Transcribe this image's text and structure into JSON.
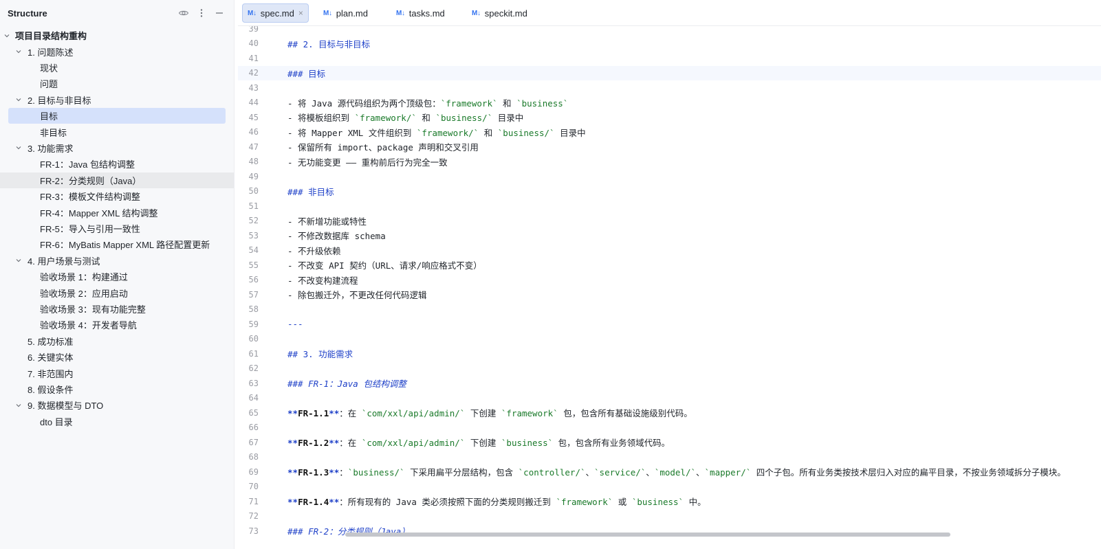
{
  "structure": {
    "title": "Structure",
    "tools": [
      "eye-icon",
      "more-vertical-icon",
      "minimize-icon"
    ],
    "items": [
      {
        "label": "项目目录结构重构",
        "level": 0,
        "expanded": true
      },
      {
        "label": "1. 问题陈述",
        "level": 1,
        "expanded": true
      },
      {
        "label": "现状",
        "level": 2
      },
      {
        "label": "问题",
        "level": 2
      },
      {
        "label": "2. 目标与非目标",
        "level": 1,
        "expanded": true
      },
      {
        "label": "目标",
        "level": 2,
        "selected": true
      },
      {
        "label": "非目标",
        "level": 2
      },
      {
        "label": "3. 功能需求",
        "level": 1,
        "expanded": true
      },
      {
        "label": "FR-1：Java 包结构调整",
        "level": 2
      },
      {
        "label": "FR-2：分类规则（Java）",
        "level": 2,
        "hover": true
      },
      {
        "label": "FR-3：模板文件结构调整",
        "level": 2
      },
      {
        "label": "FR-4：Mapper XML 结构调整",
        "level": 2
      },
      {
        "label": "FR-5：导入与引用一致性",
        "level": 2
      },
      {
        "label": "FR-6：MyBatis Mapper XML 路径配置更新",
        "level": 2
      },
      {
        "label": "4. 用户场景与测试",
        "level": 1,
        "expanded": true
      },
      {
        "label": "验收场景 1：构建通过",
        "level": 2
      },
      {
        "label": "验收场景 2：应用启动",
        "level": 2
      },
      {
        "label": "验收场景 3：现有功能完整",
        "level": 2
      },
      {
        "label": "验收场景 4：开发者导航",
        "level": 2
      },
      {
        "label": "5. 成功标准",
        "level": 1
      },
      {
        "label": "6. 关键实体",
        "level": 1
      },
      {
        "label": "7. 非范围内",
        "level": 1
      },
      {
        "label": "8. 假设条件",
        "level": 1
      },
      {
        "label": "9. 数据模型与 DTO",
        "level": 1,
        "expanded": true
      },
      {
        "label": "dto 目录",
        "level": 2
      }
    ]
  },
  "tabs": [
    {
      "badge": "M↓",
      "label": "spec.md",
      "active": true,
      "close": "×"
    },
    {
      "badge": "M↓",
      "label": "plan.md"
    },
    {
      "badge": "M↓",
      "label": "tasks.md"
    },
    {
      "badge": "M↓",
      "label": "speckit.md"
    }
  ],
  "editor": {
    "current_line": "42",
    "lines": [
      {
        "n": "39",
        "segs": []
      },
      {
        "n": "40",
        "segs": [
          {
            "c": "hd",
            "t": "## 2. 目标与非目标"
          }
        ]
      },
      {
        "n": "41",
        "segs": []
      },
      {
        "n": "42",
        "segs": [
          {
            "c": "hd",
            "t": "### 目标"
          }
        ]
      },
      {
        "n": "43",
        "segs": []
      },
      {
        "n": "44",
        "segs": [
          {
            "c": "",
            "t": "- 将 Java 源代码组织为两个顶级包："
          },
          {
            "c": "bt",
            "t": "`framework`"
          },
          {
            "c": "",
            "t": " 和 "
          },
          {
            "c": "bt",
            "t": "`business`"
          }
        ]
      },
      {
        "n": "45",
        "segs": [
          {
            "c": "",
            "t": "- 将模板组织到 "
          },
          {
            "c": "bt",
            "t": "`framework/`"
          },
          {
            "c": "",
            "t": " 和 "
          },
          {
            "c": "bt",
            "t": "`business/`"
          },
          {
            "c": "",
            "t": " 目录中"
          }
        ]
      },
      {
        "n": "46",
        "segs": [
          {
            "c": "",
            "t": "- 将 Mapper XML 文件组织到 "
          },
          {
            "c": "bt",
            "t": "`framework/`"
          },
          {
            "c": "",
            "t": " 和 "
          },
          {
            "c": "bt",
            "t": "`business/`"
          },
          {
            "c": "",
            "t": " 目录中"
          }
        ]
      },
      {
        "n": "47",
        "segs": [
          {
            "c": "",
            "t": "- 保留所有 import、package 声明和交叉引用"
          }
        ]
      },
      {
        "n": "48",
        "segs": [
          {
            "c": "",
            "t": "- 无功能变更 —— 重构前后行为完全一致"
          }
        ]
      },
      {
        "n": "49",
        "segs": []
      },
      {
        "n": "50",
        "segs": [
          {
            "c": "hd",
            "t": "### 非目标"
          }
        ]
      },
      {
        "n": "51",
        "segs": []
      },
      {
        "n": "52",
        "segs": [
          {
            "c": "",
            "t": "- 不新增功能或特性"
          }
        ]
      },
      {
        "n": "53",
        "segs": [
          {
            "c": "",
            "t": "- 不修改数据库 schema"
          }
        ]
      },
      {
        "n": "54",
        "segs": [
          {
            "c": "",
            "t": "- 不升级依赖"
          }
        ]
      },
      {
        "n": "55",
        "segs": [
          {
            "c": "",
            "t": "- 不改变 API 契约（URL、请求/响应格式不变）"
          }
        ]
      },
      {
        "n": "56",
        "segs": [
          {
            "c": "",
            "t": "- 不改变构建流程"
          }
        ]
      },
      {
        "n": "57",
        "segs": [
          {
            "c": "",
            "t": "- 除包搬迁外，不更改任何代码逻辑"
          }
        ]
      },
      {
        "n": "58",
        "segs": []
      },
      {
        "n": "59",
        "segs": [
          {
            "c": "hr",
            "t": "---"
          }
        ]
      },
      {
        "n": "60",
        "segs": []
      },
      {
        "n": "61",
        "segs": [
          {
            "c": "hd",
            "t": "## 3. 功能需求"
          }
        ]
      },
      {
        "n": "62",
        "segs": []
      },
      {
        "n": "63",
        "segs": [
          {
            "c": "hd",
            "t": "### "
          },
          {
            "c": "hd-it",
            "t": "FR-1：Java 包结构调整"
          }
        ]
      },
      {
        "n": "64",
        "segs": []
      },
      {
        "n": "65",
        "segs": [
          {
            "c": "star",
            "t": "**"
          },
          {
            "c": "bold",
            "t": "FR-1.1"
          },
          {
            "c": "star",
            "t": "**"
          },
          {
            "c": "",
            "t": "：在 "
          },
          {
            "c": "bt",
            "t": "`com/xxl/api/admin/`"
          },
          {
            "c": "",
            "t": " 下创建 "
          },
          {
            "c": "bt",
            "t": "`framework`"
          },
          {
            "c": "",
            "t": " 包，包含所有基础设施级别代码。"
          }
        ]
      },
      {
        "n": "66",
        "segs": []
      },
      {
        "n": "67",
        "segs": [
          {
            "c": "star",
            "t": "**"
          },
          {
            "c": "bold",
            "t": "FR-1.2"
          },
          {
            "c": "star",
            "t": "**"
          },
          {
            "c": "",
            "t": "：在 "
          },
          {
            "c": "bt",
            "t": "`com/xxl/api/admin/`"
          },
          {
            "c": "",
            "t": " 下创建 "
          },
          {
            "c": "bt",
            "t": "`business`"
          },
          {
            "c": "",
            "t": " 包，包含所有业务领域代码。"
          }
        ]
      },
      {
        "n": "68",
        "segs": []
      },
      {
        "n": "69",
        "segs": [
          {
            "c": "star",
            "t": "**"
          },
          {
            "c": "bold",
            "t": "FR-1.3"
          },
          {
            "c": "star",
            "t": "**"
          },
          {
            "c": "",
            "t": "："
          },
          {
            "c": "bt",
            "t": "`business/`"
          },
          {
            "c": "",
            "t": " 下采用扁平分层结构，包含 "
          },
          {
            "c": "bt",
            "t": "`controller/`"
          },
          {
            "c": "",
            "t": "、"
          },
          {
            "c": "bt",
            "t": "`service/`"
          },
          {
            "c": "",
            "t": "、"
          },
          {
            "c": "bt",
            "t": "`model/`"
          },
          {
            "c": "",
            "t": "、"
          },
          {
            "c": "bt",
            "t": "`mapper/`"
          },
          {
            "c": "",
            "t": " 四个子包。所有业务类按技术层归入对应的扁平目录，不按业务领域拆分子模块。"
          }
        ]
      },
      {
        "n": "70",
        "segs": []
      },
      {
        "n": "71",
        "segs": [
          {
            "c": "star",
            "t": "**"
          },
          {
            "c": "bold",
            "t": "FR-1.4"
          },
          {
            "c": "star",
            "t": "**"
          },
          {
            "c": "",
            "t": "：所有现有的 Java 类必须按照下面的分类规则搬迁到 "
          },
          {
            "c": "bt",
            "t": "`framework`"
          },
          {
            "c": "",
            "t": " 或 "
          },
          {
            "c": "bt",
            "t": "`business`"
          },
          {
            "c": "",
            "t": " 中。"
          }
        ]
      },
      {
        "n": "72",
        "segs": []
      },
      {
        "n": "73",
        "segs": [
          {
            "c": "hd",
            "t": "### "
          },
          {
            "c": "hd-it",
            "t": "FR-2：分类规则（Java）"
          }
        ]
      }
    ]
  }
}
